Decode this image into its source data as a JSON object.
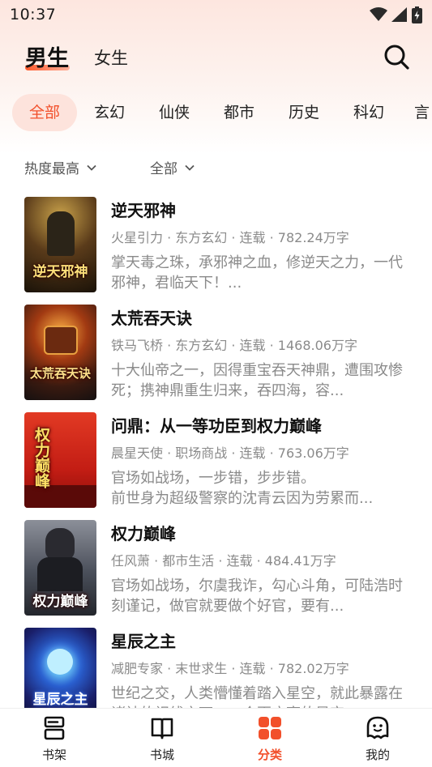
{
  "status_bar": {
    "time": "10:37"
  },
  "header": {
    "tabs": [
      {
        "label": "男生",
        "active": true
      },
      {
        "label": "女生",
        "active": false
      }
    ]
  },
  "categories": [
    "全部",
    "玄幻",
    "仙侠",
    "都市",
    "历史",
    "科幻",
    "言"
  ],
  "active_category": "全部",
  "filters": {
    "sort": "热度最高",
    "status": "全部"
  },
  "books": [
    {
      "title": "逆天邪神",
      "meta": "火星引力 · 东方玄幻 · 连载 · 782.24万字",
      "desc": "掌天毒之珠，承邪神之血，修逆天之力，一代邪神，君临天下！...",
      "cover_text": "逆天邪神"
    },
    {
      "title": "太荒吞天诀",
      "meta": "铁马飞桥 · 东方玄幻 · 连载 · 1468.06万字",
      "desc": "十大仙帝之一，因得重宝吞天神鼎，遭围攻惨死；携神鼎重生归来，吞四海，容...",
      "cover_text": "太荒吞天诀"
    },
    {
      "title": "问鼎：从一等功臣到权力巅峰",
      "meta": "晨星天使 · 职场商战 · 连载 · 763.06万字",
      "desc": "官场如战场，一步错，步步错。\n前世身为超级警察的沈青云因为劳累而...",
      "cover_text": "权力巅峰"
    },
    {
      "title": "权力巅峰",
      "meta": "任风萧 · 都市生活 · 连载 · 484.41万字",
      "desc": "官场如战场，尔虞我诈，勾心斗角，可陆浩时刻谨记，做官就要做个好官，要有...",
      "cover_text": "权力巅峰"
    },
    {
      "title": "星辰之主",
      "meta": "减肥专家 · 末世求生 · 连载 · 782.02万字",
      "desc": "世纪之交，人类懵懂着踏入星空，就此暴露在诸神的视线之下，一个更广袤的星空...",
      "cover_text": "星辰之主"
    }
  ],
  "bottom_nav": [
    {
      "label": "书架",
      "icon": "bookshelf-icon",
      "active": false
    },
    {
      "label": "书城",
      "icon": "book-open-icon",
      "active": false
    },
    {
      "label": "分类",
      "icon": "grid-icon",
      "active": true
    },
    {
      "label": "我的",
      "icon": "profile-icon",
      "active": false
    }
  ],
  "colors": {
    "accent": "#f2502b",
    "accent_bg": "#fde3dc"
  }
}
